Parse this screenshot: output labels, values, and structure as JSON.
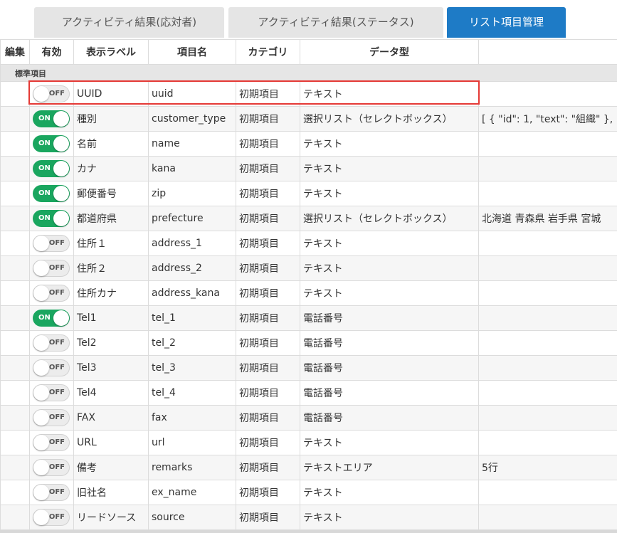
{
  "tabs": [
    {
      "label": "アクティビティ結果(応対者)",
      "active": false
    },
    {
      "label": "アクティビティ結果(ステータス)",
      "active": false
    },
    {
      "label": "リスト項目管理",
      "active": true
    }
  ],
  "table": {
    "headers": {
      "edit": "編集",
      "enabled": "有効",
      "label": "表示ラベル",
      "field": "項目名",
      "category": "カテゴリ",
      "type": "データ型",
      "options": ""
    },
    "group_label": "標準項目",
    "toggle_on_text": "ON",
    "toggle_off_text": "OFF",
    "rows": [
      {
        "on": false,
        "label": "UUID",
        "field": "uuid",
        "category": "初期項目",
        "type": "テキスト",
        "options": ""
      },
      {
        "on": true,
        "label": "種別",
        "field": "customer_type",
        "category": "初期項目",
        "type": "選択リスト（セレクトボックス）",
        "options": "[ { \"id\": 1, \"text\": \"組織\" },"
      },
      {
        "on": true,
        "label": "名前",
        "field": "name",
        "category": "初期項目",
        "type": "テキスト",
        "options": ""
      },
      {
        "on": true,
        "label": "カナ",
        "field": "kana",
        "category": "初期項目",
        "type": "テキスト",
        "options": ""
      },
      {
        "on": true,
        "label": "郵便番号",
        "field": "zip",
        "category": "初期項目",
        "type": "テキスト",
        "options": ""
      },
      {
        "on": true,
        "label": "都道府県",
        "field": "prefecture",
        "category": "初期項目",
        "type": "選択リスト（セレクトボックス）",
        "options": "北海道 青森県 岩手県 宮城"
      },
      {
        "on": false,
        "label": "住所１",
        "field": "address_1",
        "category": "初期項目",
        "type": "テキスト",
        "options": ""
      },
      {
        "on": false,
        "label": "住所２",
        "field": "address_2",
        "category": "初期項目",
        "type": "テキスト",
        "options": ""
      },
      {
        "on": false,
        "label": "住所カナ",
        "field": "address_kana",
        "category": "初期項目",
        "type": "テキスト",
        "options": ""
      },
      {
        "on": true,
        "label": "Tel1",
        "field": "tel_1",
        "category": "初期項目",
        "type": "電話番号",
        "options": ""
      },
      {
        "on": false,
        "label": "Tel2",
        "field": "tel_2",
        "category": "初期項目",
        "type": "電話番号",
        "options": ""
      },
      {
        "on": false,
        "label": "Tel3",
        "field": "tel_3",
        "category": "初期項目",
        "type": "電話番号",
        "options": ""
      },
      {
        "on": false,
        "label": "Tel4",
        "field": "tel_4",
        "category": "初期項目",
        "type": "電話番号",
        "options": ""
      },
      {
        "on": false,
        "label": "FAX",
        "field": "fax",
        "category": "初期項目",
        "type": "電話番号",
        "options": ""
      },
      {
        "on": false,
        "label": "URL",
        "field": "url",
        "category": "初期項目",
        "type": "テキスト",
        "options": ""
      },
      {
        "on": false,
        "label": "備考",
        "field": "remarks",
        "category": "初期項目",
        "type": "テキストエリア",
        "options": "5行"
      },
      {
        "on": false,
        "label": "旧社名",
        "field": "ex_name",
        "category": "初期項目",
        "type": "テキスト",
        "options": ""
      },
      {
        "on": false,
        "label": "リードソース",
        "field": "source",
        "category": "初期項目",
        "type": "テキスト",
        "options": ""
      }
    ]
  },
  "colors": {
    "active_tab": "#1e7bc6",
    "toggle_on": "#1aa65f",
    "highlight": "#e53935"
  }
}
